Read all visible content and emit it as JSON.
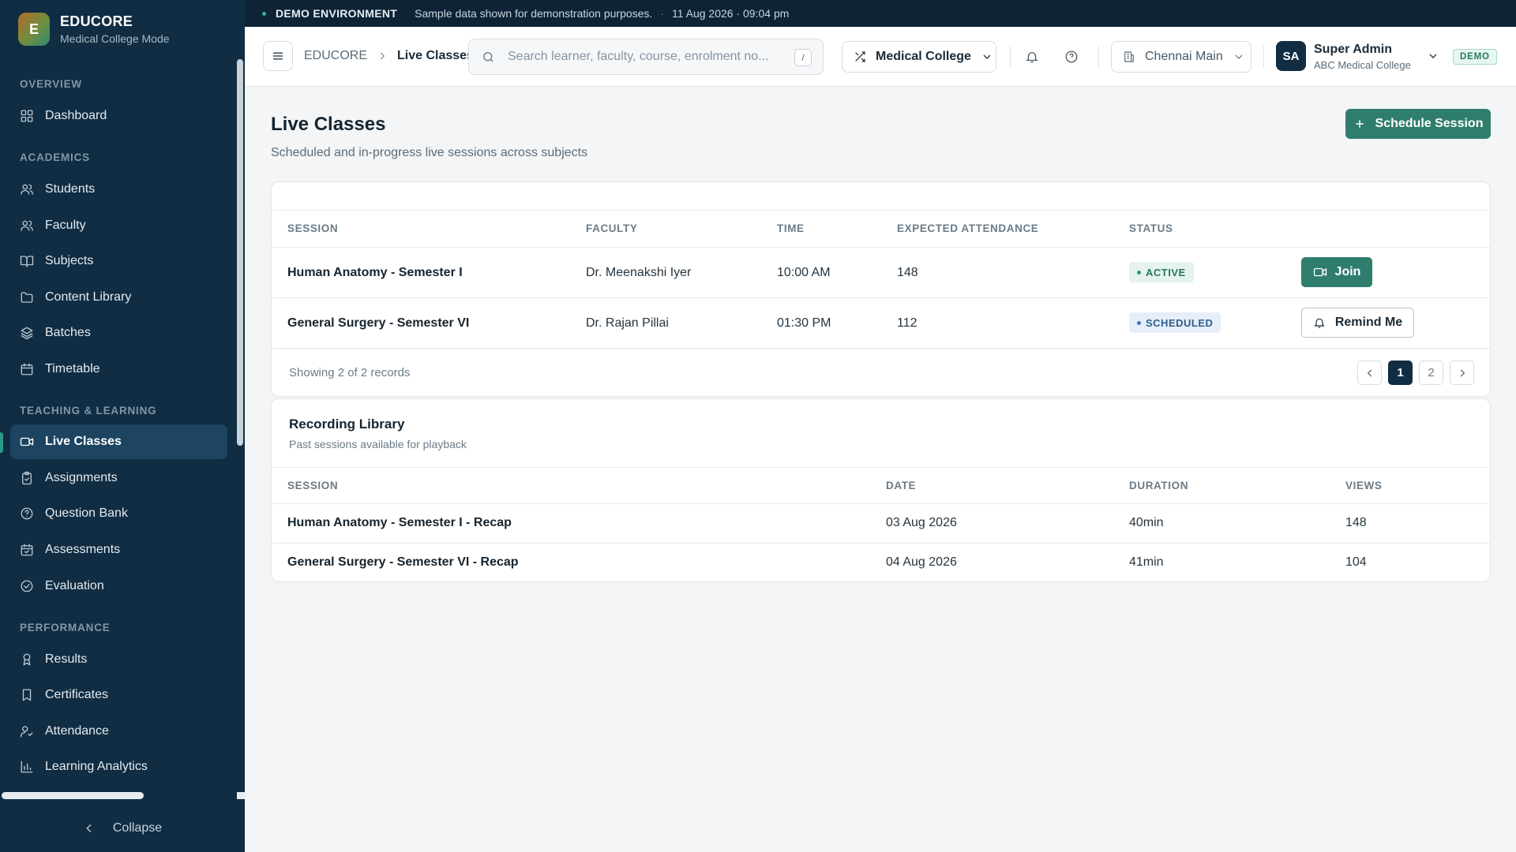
{
  "brand": {
    "initial": "E",
    "name": "EDUCORE",
    "mode": "Medical College Mode"
  },
  "sidebar": {
    "sections": [
      {
        "title": "OVERVIEW"
      },
      {
        "title": "ACADEMICS"
      },
      {
        "title": "TEACHING & LEARNING"
      },
      {
        "title": "PERFORMANCE"
      }
    ],
    "items": [
      {
        "label": "Dashboard",
        "icon": "grid-icon"
      },
      {
        "label": "Students",
        "icon": "users-icon"
      },
      {
        "label": "Faculty",
        "icon": "users-icon"
      },
      {
        "label": "Subjects",
        "icon": "book-open-icon"
      },
      {
        "label": "Content Library",
        "icon": "folder-icon"
      },
      {
        "label": "Batches",
        "icon": "layers-icon"
      },
      {
        "label": "Timetable",
        "icon": "calendar-icon"
      },
      {
        "label": "Live Classes",
        "icon": "video-icon",
        "active": true
      },
      {
        "label": "Assignments",
        "icon": "clipboard-icon"
      },
      {
        "label": "Question Bank",
        "icon": "help-circle-icon"
      },
      {
        "label": "Assessments",
        "icon": "calendar-check-icon"
      },
      {
        "label": "Evaluation",
        "icon": "check-circle-icon"
      },
      {
        "label": "Results",
        "icon": "award-icon"
      },
      {
        "label": "Certificates",
        "icon": "bookmark-icon"
      },
      {
        "label": "Attendance",
        "icon": "user-check-icon"
      },
      {
        "label": "Learning Analytics",
        "icon": "bar-chart-icon"
      }
    ],
    "collapse_label": "Collapse"
  },
  "banner": {
    "tag": "DEMO ENVIRONMENT",
    "message": "Sample data shown for demonstration purposes.",
    "timestamp": "11 Aug 2026 · 09:04 pm"
  },
  "header": {
    "breadcrumb_root": "EDUCORE",
    "breadcrumb_current": "Live Classes",
    "search_placeholder": "Search learner, faculty, course, enrolment no...",
    "search_shortcut": "/",
    "mode_select": "Medical College",
    "campus_select": "Chennai Main",
    "user_initials": "SA",
    "user_name": "Super Admin",
    "user_org": "ABC Medical College",
    "env_badge": "DEMO"
  },
  "page": {
    "title": "Live Classes",
    "subtitle": "Scheduled and in-progress live sessions across subjects",
    "primary_action": "Schedule Session"
  },
  "sessions_table": {
    "columns": [
      "SESSION",
      "FACULTY",
      "TIME",
      "EXPECTED ATTENDANCE",
      "STATUS"
    ],
    "rows": [
      {
        "session": "Human Anatomy - Semester I",
        "faculty": "Dr. Meenakshi Iyer",
        "time": "10:00 AM",
        "attendance": "148",
        "status": "ACTIVE",
        "action": "Join"
      },
      {
        "session": "General Surgery - Semester VI",
        "faculty": "Dr. Rajan Pillai",
        "time": "01:30 PM",
        "attendance": "112",
        "status": "SCHEDULED",
        "action": "Remind Me"
      }
    ],
    "records_text": "Showing 2 of 2 records",
    "pages": [
      "1",
      "2"
    ],
    "current_page": "1"
  },
  "recordings": {
    "title": "Recording Library",
    "subtitle": "Past sessions available for playback",
    "columns": [
      "SESSION",
      "DATE",
      "DURATION",
      "VIEWS"
    ],
    "rows": [
      {
        "session": "Human Anatomy - Semester I - Recap",
        "date": "03 Aug 2026",
        "duration": "40min",
        "views": "148"
      },
      {
        "session": "General Surgery - Semester VI - Recap",
        "date": "04 Aug 2026",
        "duration": "41min",
        "views": "104"
      }
    ]
  },
  "colors": {
    "sidebar_bg": "#112d43",
    "accent": "#2f7e6d",
    "active_status": "#287a5f",
    "scheduled_status": "#2f5f8e"
  }
}
